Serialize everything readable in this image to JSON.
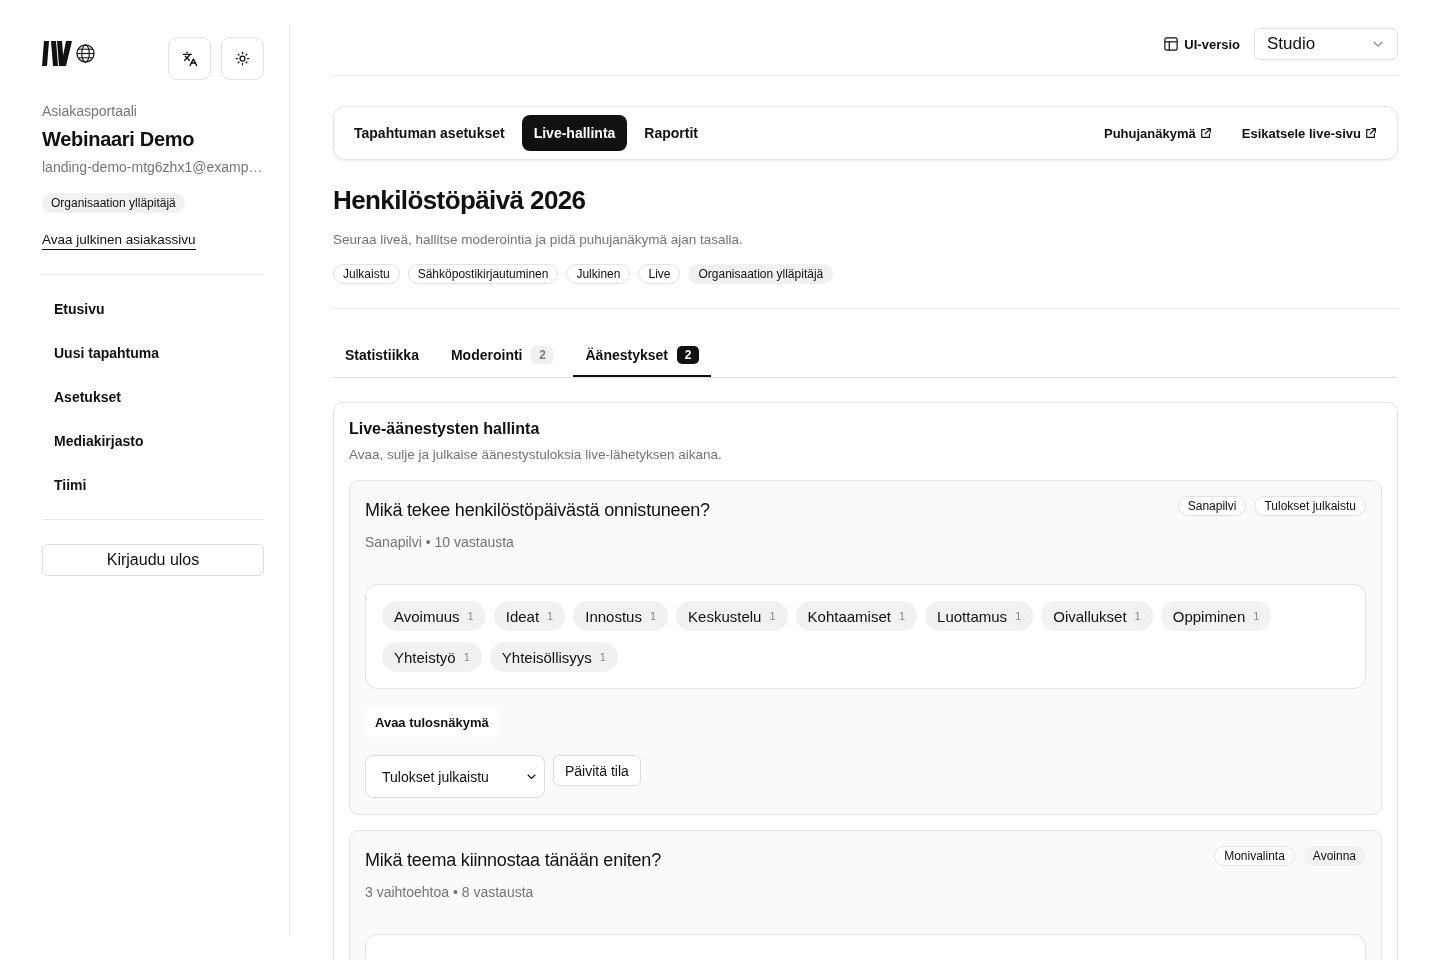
{
  "sidebar": {
    "portal_label": "Asiakasportaali",
    "org_name": "Webinaari Demo",
    "email": "landing-demo-mtg6zhx1@examp…",
    "role_badge": "Organisaation ylläpitäjä",
    "public_page_link": "Avaa julkinen asiakassivu",
    "nav_items": [
      {
        "label": "Etusivu"
      },
      {
        "label": "Uusi tapahtuma"
      },
      {
        "label": "Asetukset"
      },
      {
        "label": "Mediakirjasto"
      },
      {
        "label": "Tiimi"
      }
    ],
    "logout_button": "Kirjaudu ulos"
  },
  "header": {
    "ui_version_label": "UI-versio",
    "ui_version_select": {
      "value": "Studio"
    }
  },
  "page_tabs": [
    {
      "label": "Tapahtuman asetukset",
      "selected": false
    },
    {
      "label": "Live-hallinta",
      "selected": true
    },
    {
      "label": "Raportit",
      "selected": false
    }
  ],
  "page_links": [
    {
      "label": "Puhujanäkymä"
    },
    {
      "label": "Esikatsele live-sivu"
    }
  ],
  "event": {
    "title": "Henkilöstöpäivä 2026",
    "description": "Seuraa liveä, hallitse moderointia ja pidä puhujanäkymä ajan tasalla.",
    "badges": [
      {
        "label": "Julkaistu",
        "kind": "outline"
      },
      {
        "label": "Sähköpostikirjautuminen",
        "kind": "outline"
      },
      {
        "label": "Julkinen",
        "kind": "outline"
      },
      {
        "label": "Live",
        "kind": "outline"
      },
      {
        "label": "Organisaation ylläpitäjä",
        "kind": "soft"
      }
    ]
  },
  "section_tabs": [
    {
      "label": "Statistiikka",
      "selected": false
    },
    {
      "label": "Moderointi",
      "count": "2",
      "selected": false
    },
    {
      "label": "Äänestykset",
      "count": "2",
      "selected": true
    }
  ],
  "polls_panel": {
    "title": "Live-äänestysten hallinta",
    "description": "Avaa, sulje ja julkaise äänestystuloksia live-lähetyksen aikana.",
    "polls": [
      {
        "question": "Mikä tekee henkilöstöpäivästä onnistuneen?",
        "badges": [
          {
            "label": "Sanapilvi",
            "kind": "outline"
          },
          {
            "label": "Tulokset julkaistu",
            "kind": "outline"
          }
        ],
        "meta": "Sanapilvi • 10 vastausta",
        "kind": "word_cloud",
        "words": [
          {
            "word": "Avoimuus",
            "count": "1"
          },
          {
            "word": "Ideat",
            "count": "1"
          },
          {
            "word": "Innostus",
            "count": "1"
          },
          {
            "word": "Keskustelu",
            "count": "1"
          },
          {
            "word": "Kohtaamiset",
            "count": "1"
          },
          {
            "word": "Luottamus",
            "count": "1"
          },
          {
            "word": "Oivallukset",
            "count": "1"
          },
          {
            "word": "Oppiminen",
            "count": "1"
          },
          {
            "word": "Yhteistyö",
            "count": "1"
          },
          {
            "word": "Yhteisöllisyys",
            "count": "1"
          }
        ],
        "results_button": "Avaa tulosnäkymä",
        "status_select": {
          "value": "Tulokset julkaistu"
        },
        "update_button": "Päivitä tila"
      },
      {
        "question": "Mikä teema kiinnostaa tänään eniten?",
        "badges": [
          {
            "label": "Monivalinta",
            "kind": "outline"
          },
          {
            "label": "Avoinna",
            "kind": "soft"
          }
        ],
        "meta": "3 vaihtoehtoa • 8 vastausta",
        "kind": "multiple_choice"
      }
    ]
  }
}
